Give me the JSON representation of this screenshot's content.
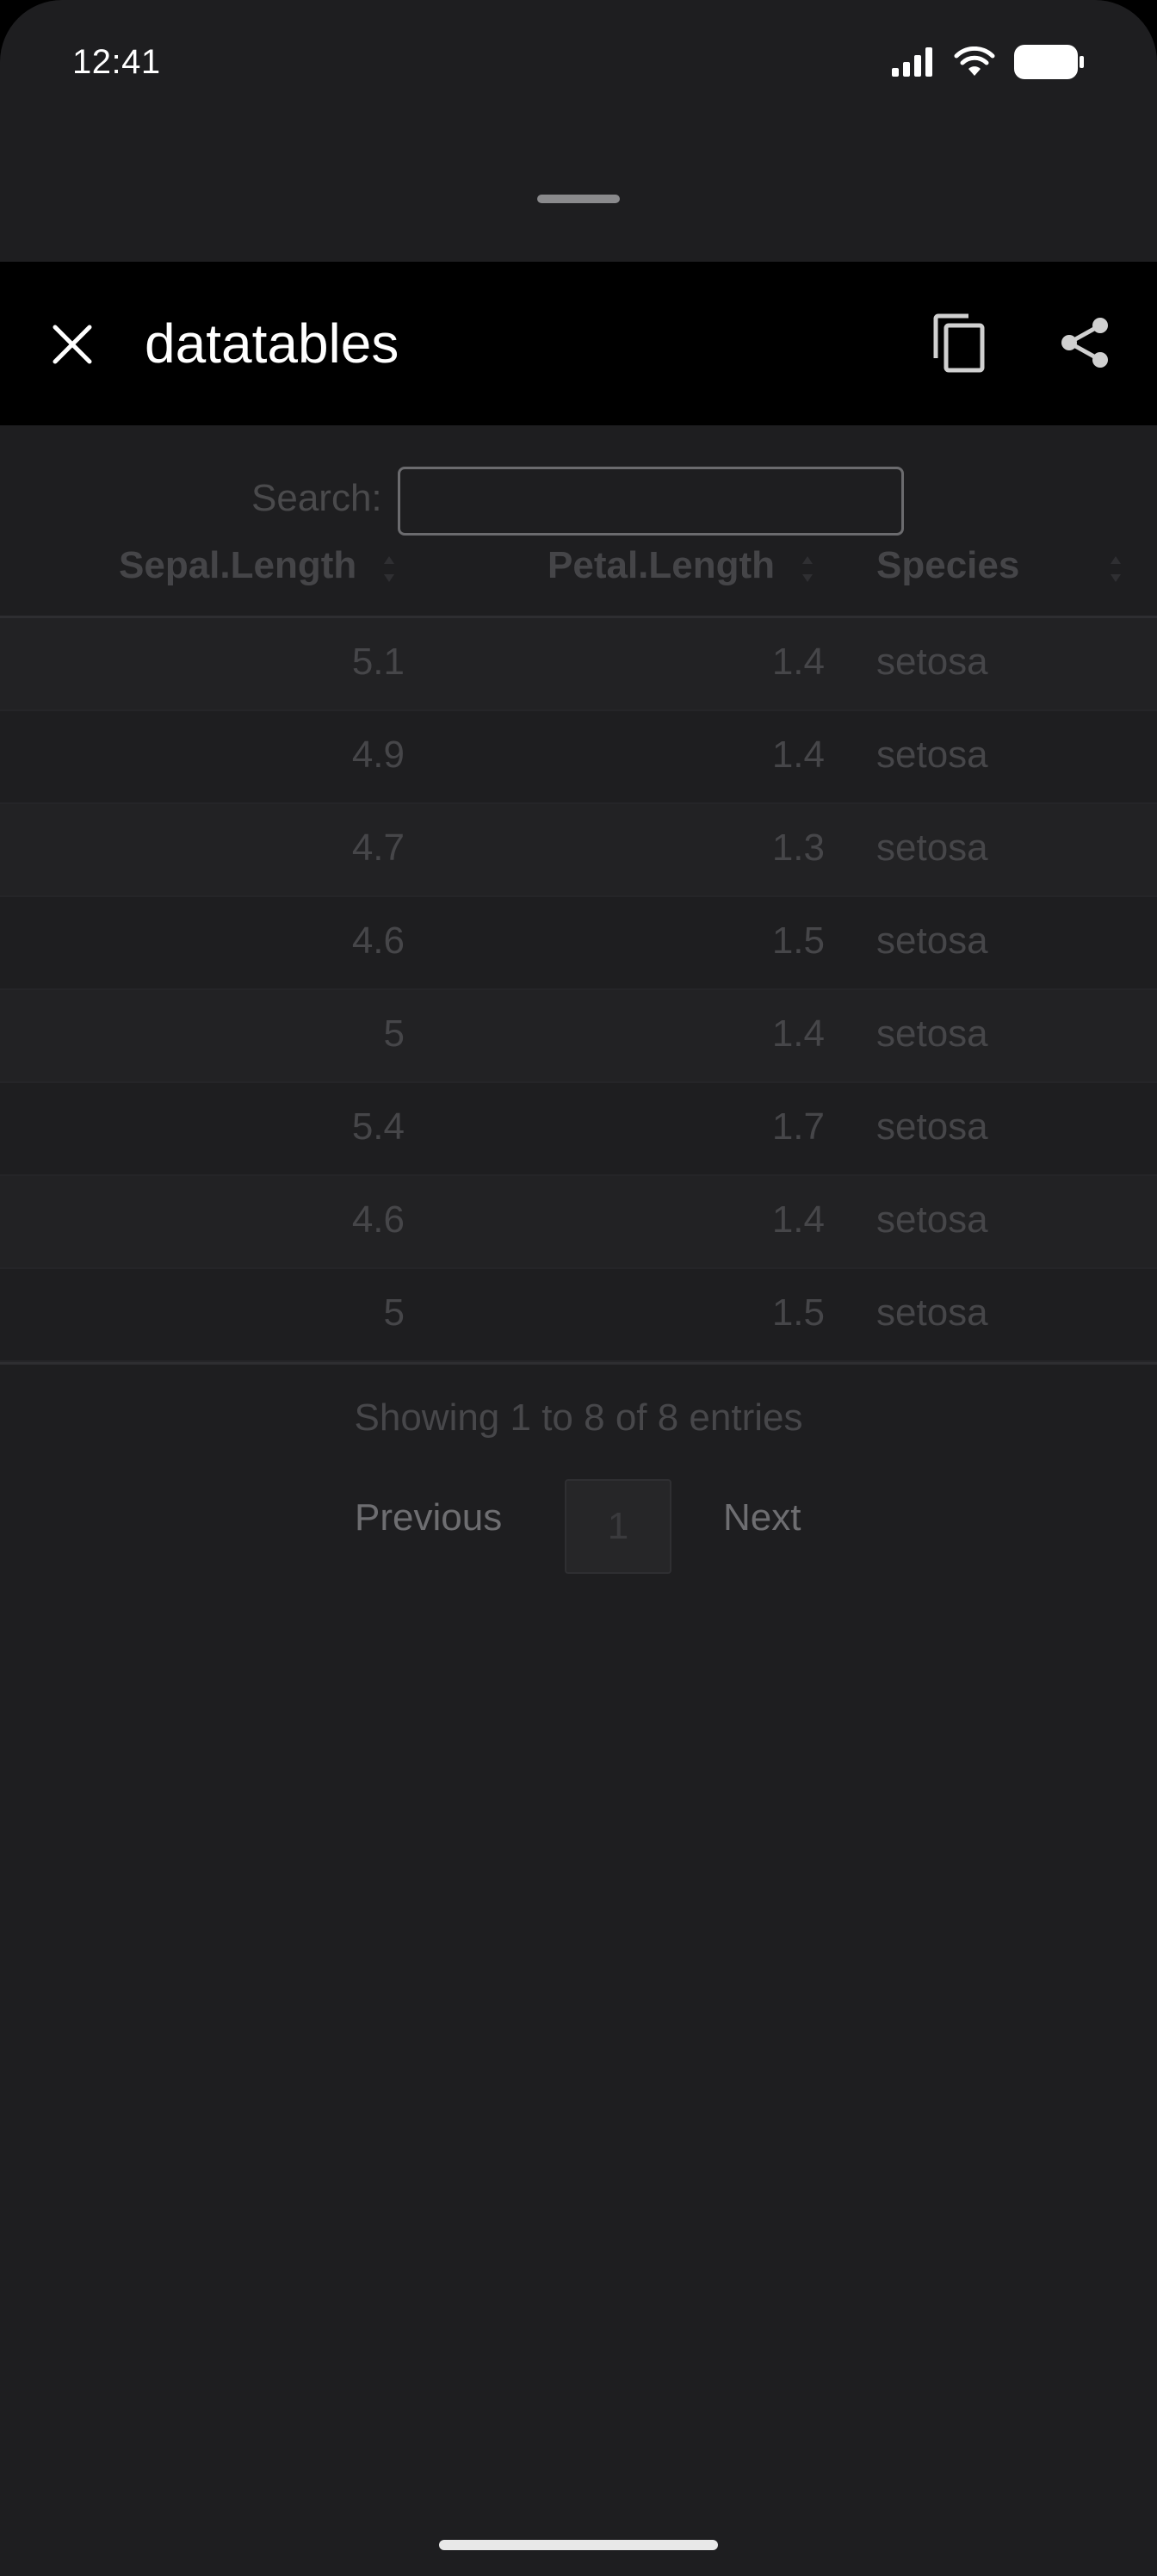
{
  "status_bar": {
    "time": "12:41"
  },
  "toolbar": {
    "title": "datatables"
  },
  "search": {
    "label": "Search:",
    "value": "",
    "placeholder": ""
  },
  "table": {
    "columns": [
      "Sepal.Length",
      "Petal.Length",
      "Species"
    ],
    "rows": [
      [
        "5.1",
        "1.4",
        "setosa"
      ],
      [
        "4.9",
        "1.4",
        "setosa"
      ],
      [
        "4.7",
        "1.3",
        "setosa"
      ],
      [
        "4.6",
        "1.5",
        "setosa"
      ],
      [
        "5",
        "1.4",
        "setosa"
      ],
      [
        "5.4",
        "1.7",
        "setosa"
      ],
      [
        "4.6",
        "1.4",
        "setosa"
      ],
      [
        "5",
        "1.5",
        "setosa"
      ]
    ]
  },
  "info": "Showing 1 to 8 of 8 entries",
  "pagination": {
    "previous": "Previous",
    "current": "1",
    "next": "Next"
  },
  "icons": {
    "close": "close-icon",
    "copy": "copy-icon",
    "share": "share-icon",
    "signal": "signal-icon",
    "wifi": "wifi-icon",
    "battery": "battery-icon"
  },
  "colors": {
    "toolbar_bg": "#000000",
    "sheet_bg": "#1e1e20"
  }
}
